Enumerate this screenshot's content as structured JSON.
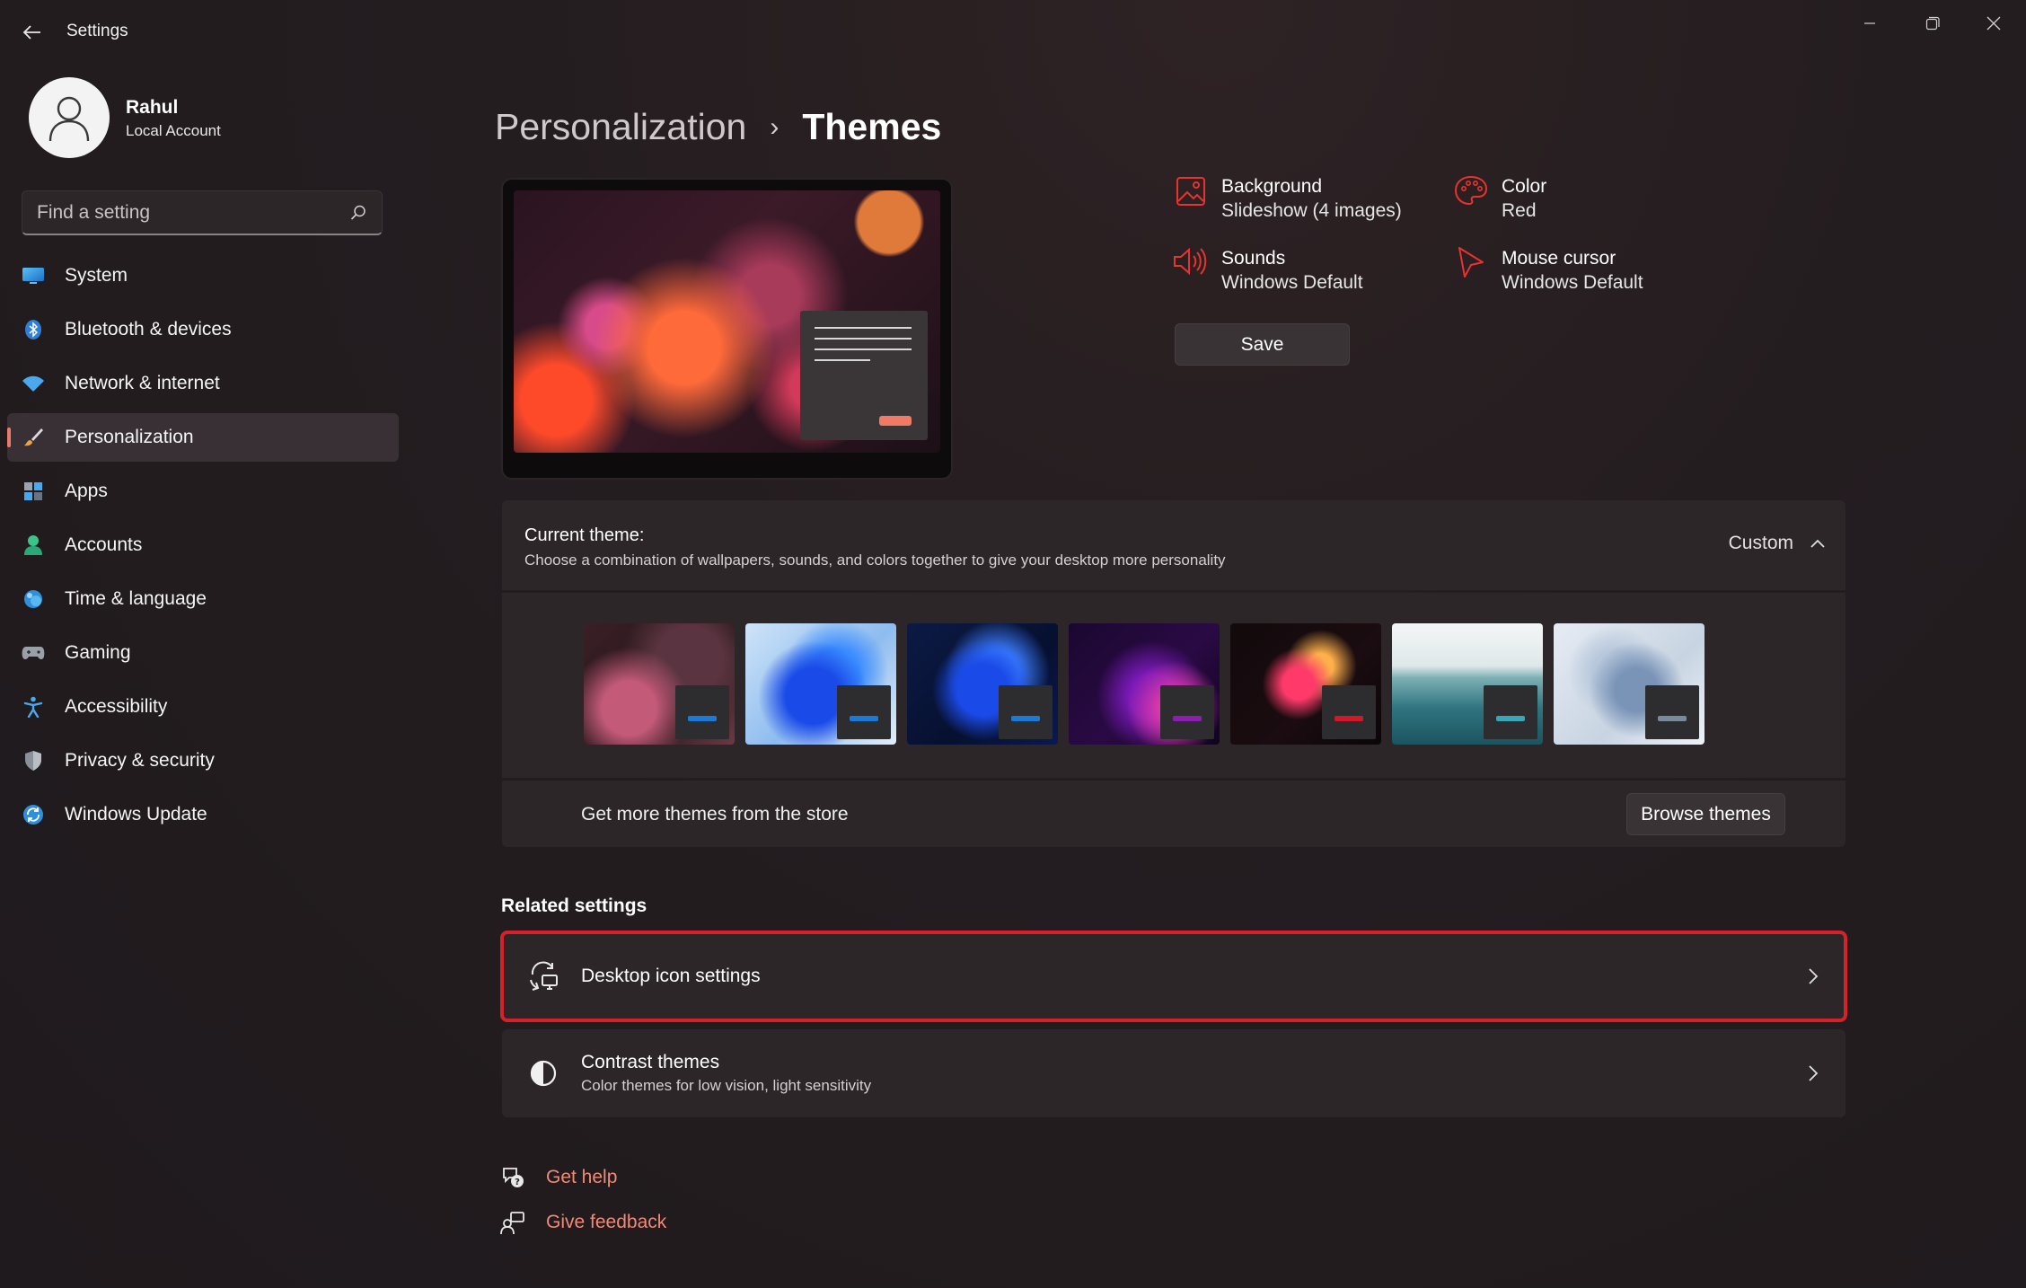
{
  "window": {
    "title": "Settings",
    "minimize_icon": "minimize-icon",
    "maximize_icon": "maximize-icon",
    "close_icon": "close-icon"
  },
  "user": {
    "name": "Rahul",
    "account_type": "Local Account"
  },
  "search": {
    "placeholder": "Find a setting"
  },
  "nav": {
    "items": [
      {
        "label": "System",
        "icon": "system-icon"
      },
      {
        "label": "Bluetooth & devices",
        "icon": "bluetooth-icon"
      },
      {
        "label": "Network & internet",
        "icon": "wifi-icon"
      },
      {
        "label": "Personalization",
        "icon": "brush-icon",
        "active": true
      },
      {
        "label": "Apps",
        "icon": "apps-icon"
      },
      {
        "label": "Accounts",
        "icon": "accounts-icon"
      },
      {
        "label": "Time & language",
        "icon": "globe-icon"
      },
      {
        "label": "Gaming",
        "icon": "gamepad-icon"
      },
      {
        "label": "Accessibility",
        "icon": "accessibility-icon"
      },
      {
        "label": "Privacy & security",
        "icon": "shield-icon"
      },
      {
        "label": "Windows Update",
        "icon": "update-icon"
      }
    ]
  },
  "breadcrumb": {
    "parent": "Personalization",
    "separator": "›",
    "current": "Themes"
  },
  "properties": {
    "background": {
      "title": "Background",
      "value": "Slideshow (4 images)"
    },
    "color": {
      "title": "Color",
      "value": "Red"
    },
    "sounds": {
      "title": "Sounds",
      "value": "Windows Default"
    },
    "mouse_cursor": {
      "title": "Mouse cursor",
      "value": "Windows Default"
    },
    "save_label": "Save"
  },
  "current_theme": {
    "title": "Current theme:",
    "description": "Choose a combination of wallpapers, sounds, and colors together to give your desktop more personality",
    "value": "Custom"
  },
  "themes": [
    {
      "name": "theme-1",
      "accent": "#1c7ad4"
    },
    {
      "name": "theme-2",
      "accent": "#1c7ad4"
    },
    {
      "name": "theme-3",
      "accent": "#1c7ad4"
    },
    {
      "name": "theme-4",
      "accent": "#8a1fb0"
    },
    {
      "name": "theme-5",
      "accent": "#d01a2a"
    },
    {
      "name": "theme-6",
      "accent": "#3aa6b8"
    },
    {
      "name": "theme-7",
      "accent": "#7a8a9a"
    }
  ],
  "store": {
    "label": "Get more themes from the store",
    "button": "Browse themes"
  },
  "related": {
    "title": "Related settings",
    "desktop_icons": {
      "title": "Desktop icon settings"
    },
    "contrast": {
      "title": "Contrast themes",
      "subtitle": "Color themes for low vision, light sensitivity"
    }
  },
  "help": {
    "get_help": "Get help",
    "feedback": "Give feedback"
  },
  "colors": {
    "accent": "#ec7a6a",
    "highlight_border": "#d6202a",
    "link": "#f08a78"
  }
}
